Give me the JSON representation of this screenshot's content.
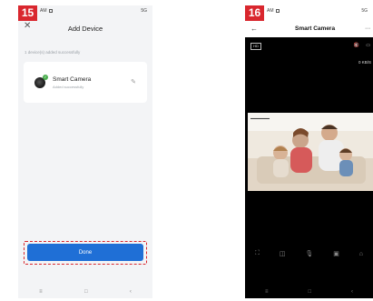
{
  "screen1": {
    "step": "15",
    "status_time": "AM",
    "status_right": "5G",
    "title": "Add Device",
    "close_icon": "✕",
    "subtitle": "1 device(s) added successfully",
    "device": {
      "name": "Smart Camera",
      "status": "Added successfully",
      "check": "✓",
      "edit_icon": "✎"
    },
    "done_label": "Done",
    "nav": [
      "≡",
      "□",
      "‹"
    ]
  },
  "screen2": {
    "step": "16",
    "status_time": "AM",
    "status_right": "5G",
    "back_icon": "←",
    "title": "Smart Camera",
    "more_icon": "⋯",
    "hd_label": "HD",
    "mute_icon": "🔇",
    "screen_icon": "▭",
    "speed": "0 KB/S",
    "controls": [
      "⛶",
      "◫",
      "🎙",
      "▣",
      "⌂"
    ],
    "nav": [
      "≡",
      "□",
      "‹"
    ]
  },
  "colors": {
    "accent": "#1f6fd6",
    "badge": "#d9272e",
    "success": "#4caf50"
  }
}
